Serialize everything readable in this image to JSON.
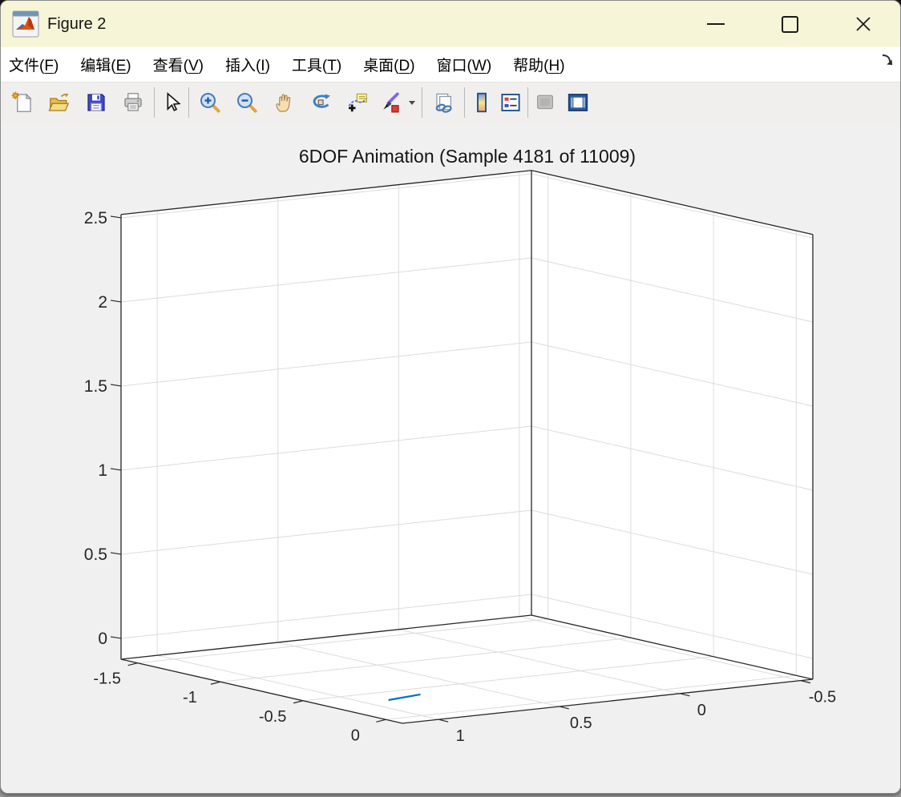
{
  "window": {
    "title": "Figure 2",
    "controls": [
      {
        "name": "minimize"
      },
      {
        "name": "maximize"
      },
      {
        "name": "close"
      }
    ]
  },
  "menu": {
    "items": [
      {
        "name": "file",
        "pre": "文件(",
        "key": "F",
        "post": ")"
      },
      {
        "name": "edit",
        "pre": "编辑(",
        "key": "E",
        "post": ")"
      },
      {
        "name": "view",
        "pre": "查看(",
        "key": "V",
        "post": ")"
      },
      {
        "name": "insert",
        "pre": "插入(",
        "key": "I",
        "post": ")"
      },
      {
        "name": "tools",
        "pre": "工具(",
        "key": "T",
        "post": ")"
      },
      {
        "name": "desktop",
        "pre": "桌面(",
        "key": "D",
        "post": ")"
      },
      {
        "name": "window",
        "pre": "窗口(",
        "key": "W",
        "post": ")"
      },
      {
        "name": "help",
        "pre": "帮助(",
        "key": "H",
        "post": ")"
      }
    ],
    "dock_arrow_icon": "dock-figure-arrow-icon"
  },
  "toolbar": {
    "icons": [
      "new-document-icon",
      "open-folder-icon",
      "save-floppy-icon",
      "print-icon",
      "edit-plot-arrow-icon",
      "zoom-in-icon",
      "zoom-out-icon",
      "pan-hand-icon",
      "rotate-3d-icon",
      "data-cursor-icon",
      "brush-icon",
      "brush-dropdown-caret-icon",
      "link-plot-icon",
      "colorbar-icon",
      "legend-icon",
      "hide-plot-tools-icon",
      "dock-figure-icon"
    ]
  },
  "figure": {
    "background": "#f0f0f0",
    "titlebar_color": "#f6f5d8"
  },
  "chart_data": {
    "type": "line",
    "projection": "3d",
    "title": "6DOF Animation (Sample 4181 of 11009)",
    "xticks": [
      -1.5,
      -1,
      -0.5,
      0
    ],
    "yticks": [
      1,
      0.5,
      0,
      -0.5
    ],
    "zticks": [
      0,
      0.5,
      1,
      1.5,
      2,
      2.5
    ],
    "xlim": [
      -1.6,
      0.1
    ],
    "ylim": [
      -0.55,
      1.15
    ],
    "zlim": [
      -0.124,
      2.52
    ],
    "grid": true,
    "view": {
      "azimuth_deg": -37.5,
      "elevation_deg": 30
    },
    "colors": {
      "trajectory": "#0072BD",
      "grid": "#dcdcdc",
      "axis": "#262626",
      "walls": "#ffffff"
    },
    "series": [
      {
        "name": "trajectory",
        "color": "#0072BD",
        "points": [
          {
            "x": 0.03,
            "y": 1.16,
            "z": 0
          },
          {
            "x": -0.01,
            "y": 1.0,
            "z": 0
          }
        ]
      }
    ]
  }
}
